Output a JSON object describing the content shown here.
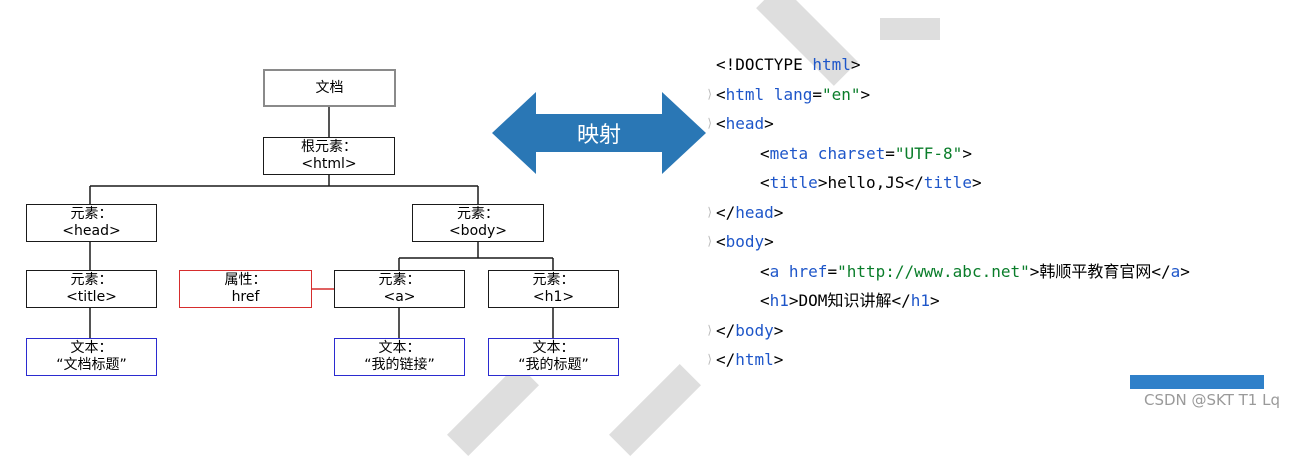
{
  "colors": {
    "arrow": "#2a77b5",
    "code_keyword": "#1e56c9",
    "code_string": "#0a7d2a",
    "attr_border": "#d62d2d",
    "text_border": "#2b2bd0"
  },
  "tree": {
    "document": "文档",
    "root": {
      "label": "根元素：",
      "tag": "<html>"
    },
    "head": {
      "label": "元素：",
      "tag": "<head>"
    },
    "body": {
      "label": "元素：",
      "tag": "<body>"
    },
    "title": {
      "label": "元素：",
      "tag": "<title>"
    },
    "attr": {
      "label": "属性：",
      "tag": "href"
    },
    "a": {
      "label": "元素：",
      "tag": "<a>"
    },
    "h1": {
      "label": "元素：",
      "tag": "<h1>"
    },
    "text_title": {
      "label": "文本：",
      "value": "“文档标题”"
    },
    "text_a": {
      "label": "文本：",
      "value": "“我的链接”"
    },
    "text_h1": {
      "label": "文本：",
      "value": "“我的标题”"
    }
  },
  "arrow_label": "映射",
  "code": {
    "l1": {
      "a": "<!DOCTYPE ",
      "b": "html",
      "c": ">"
    },
    "l2": {
      "a": "<",
      "b": "html lang",
      "c": "=",
      "d": "\"en\"",
      "e": ">"
    },
    "l3": {
      "a": "<",
      "b": "head",
      "c": ">"
    },
    "l4": {
      "a": "<",
      "b": "meta charset",
      "c": "=",
      "d": "\"UTF-8\"",
      "e": ">"
    },
    "l5": {
      "a": "<",
      "b": "title",
      "c": ">hello,JS</",
      "d": "title",
      "e": ">"
    },
    "l6": {
      "a": "</",
      "b": "head",
      "c": ">"
    },
    "l7": {
      "a": "<",
      "b": "body",
      "c": ">"
    },
    "l8": {
      "a": "<",
      "b": "a href",
      "c": "=",
      "d": "\"http://www.abc.net\"",
      "e": ">韩顺平教育官网</",
      "f": "a",
      "g": ">"
    },
    "l9": {
      "a": "<",
      "b": "h1",
      "c": ">DOM知识讲解</",
      "d": "h1",
      "e": ">"
    },
    "l10": {
      "a": "</",
      "b": "body",
      "c": ">"
    },
    "l11": {
      "a": "</",
      "b": "html",
      "c": ">"
    },
    "fold_marker": "⟩"
  },
  "watermark": "CSDN @SKT T1 Lq"
}
